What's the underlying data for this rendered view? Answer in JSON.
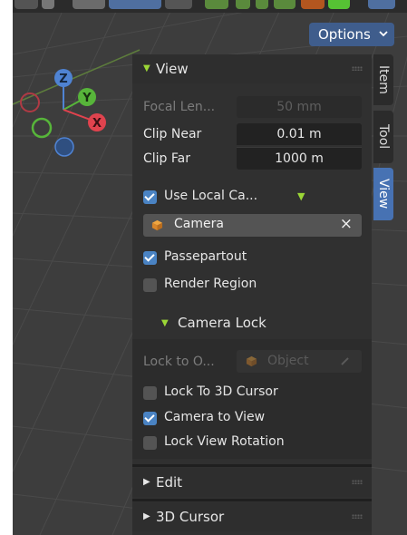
{
  "header": {
    "options_label": "Options"
  },
  "panel": {
    "view": {
      "title": "View",
      "focal_length": {
        "label": "Focal Len...",
        "value": "50 mm"
      },
      "clip_near": {
        "label": "Clip Near",
        "value": "0.01 m"
      },
      "clip_far": {
        "label": "Clip Far",
        "value": "1000 m"
      },
      "use_local_camera": {
        "label": "Use Local Ca...",
        "checked": true
      },
      "camera_field": {
        "value": "Camera",
        "clear_icon": "×"
      },
      "passepartout": {
        "label": "Passepartout",
        "checked": true
      },
      "render_region": {
        "label": "Render Region",
        "checked": false
      }
    },
    "camera_lock": {
      "title": "Camera Lock",
      "lock_to_object": {
        "label": "Lock to O...",
        "placeholder": "Object"
      },
      "lock_to_3d_cursor": {
        "label": "Lock To 3D Cursor",
        "checked": false
      },
      "camera_to_view": {
        "label": "Camera to View",
        "checked": true
      },
      "lock_view_rotation": {
        "label": "Lock View Rotation",
        "checked": false
      }
    },
    "edit": {
      "title": "Edit"
    },
    "cursor_3d": {
      "title": "3D Cursor"
    }
  },
  "tabs": [
    "Item",
    "Tool",
    "View"
  ],
  "gizmo": {
    "x": "X",
    "y": "Y",
    "z": "Z"
  },
  "colors": {
    "accent_blue": "#4772b3",
    "checkbox_blue": "#4a83c3",
    "axis_x": "#e0434e",
    "axis_y": "#57b53a",
    "axis_z": "#4f83d3",
    "expand_triangle": "#9bd636"
  }
}
